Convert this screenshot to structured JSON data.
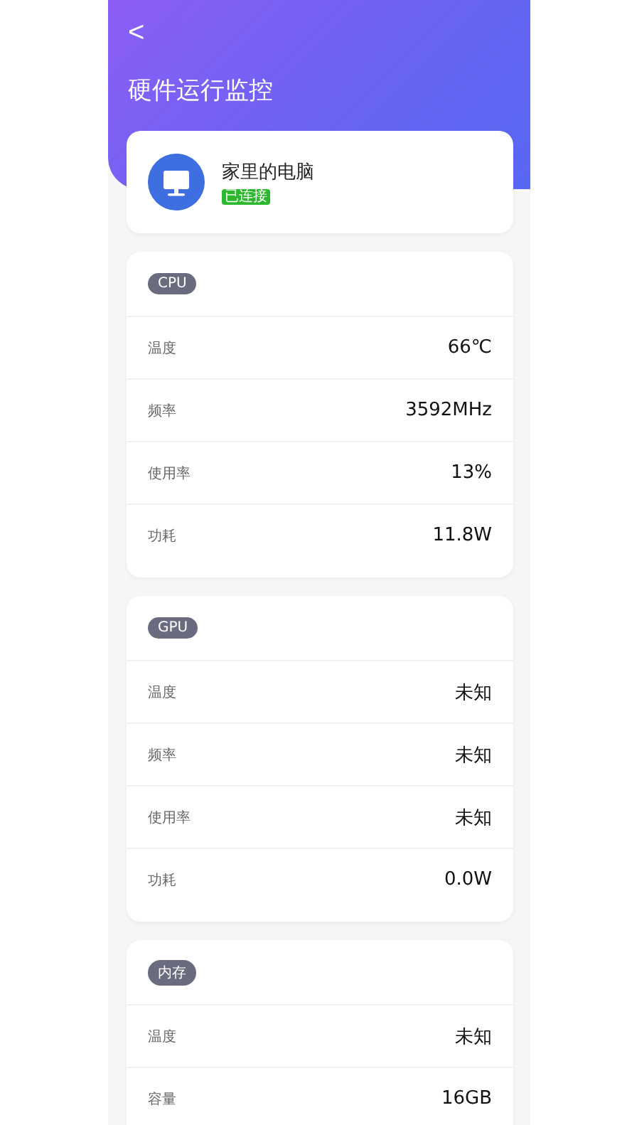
{
  "header": {
    "back": "<",
    "title": "硬件运行监控"
  },
  "device": {
    "name": "家里的电脑",
    "status": "已连接",
    "connected": true
  },
  "sections": [
    {
      "tag": "CPU",
      "rows": [
        {
          "label": "温度",
          "value": "66℃"
        },
        {
          "label": "频率",
          "value": "3592MHz"
        },
        {
          "label": "使用率",
          "value": "13%"
        },
        {
          "label": "功耗",
          "value": "11.8W"
        }
      ]
    },
    {
      "tag": "GPU",
      "rows": [
        {
          "label": "温度",
          "value": "未知"
        },
        {
          "label": "频率",
          "value": "未知"
        },
        {
          "label": "使用率",
          "value": "未知"
        },
        {
          "label": "功耗",
          "value": "0.0W"
        }
      ]
    },
    {
      "tag": "内存",
      "rows": [
        {
          "label": "温度",
          "value": "未知"
        },
        {
          "label": "容量",
          "value": "16GB"
        }
      ]
    }
  ]
}
